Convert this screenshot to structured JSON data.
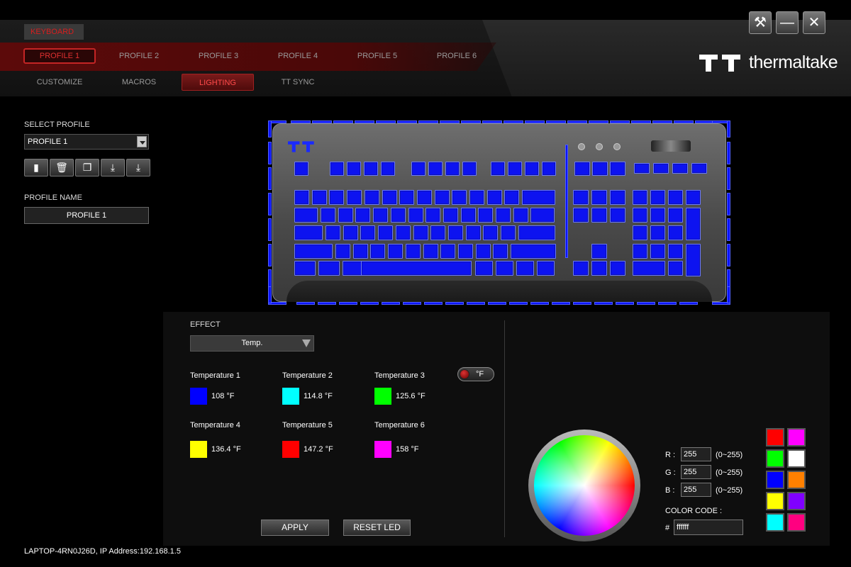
{
  "device_tab": "KEYBOARD",
  "profiles": [
    "PROFILE 1",
    "PROFILE 2",
    "PROFILE 3",
    "PROFILE 4",
    "PROFILE 5",
    "PROFILE 6"
  ],
  "sections": [
    "CUSTOMIZE",
    "MACROS",
    "LIGHTING",
    "TT SYNC"
  ],
  "brand": "thermaltake",
  "left": {
    "select_profile_label": "SELECT PROFILE",
    "selected_profile": "PROFILE 1",
    "profile_name_label": "PROFILE NAME",
    "profile_name": "PROFILE 1"
  },
  "effect": {
    "label": "EFFECT",
    "value": "Temp."
  },
  "unit_toggle": "°F",
  "temperatures": [
    {
      "title": "Temperature 1",
      "value": "108 °F",
      "color": "#0000ff"
    },
    {
      "title": "Temperature 2",
      "value": "114.8 °F",
      "color": "#00ffff"
    },
    {
      "title": "Temperature 3",
      "value": "125.6 °F",
      "color": "#00ff00"
    },
    {
      "title": "Temperature 4",
      "value": "136.4 °F",
      "color": "#ffff00"
    },
    {
      "title": "Temperature 5",
      "value": "147.2 °F",
      "color": "#ff0000"
    },
    {
      "title": "Temperature 6",
      "value": "158 °F",
      "color": "#ff00ff"
    }
  ],
  "buttons": {
    "apply": "APPLY",
    "reset": "RESET LED"
  },
  "rgb": {
    "r_label": "R :",
    "g_label": "G :",
    "b_label": "B :",
    "r": "255",
    "g": "255",
    "b": "255",
    "range": "(0~255)",
    "code_label": "COLOR CODE :",
    "hash": "#",
    "code": "ffffff"
  },
  "presets": [
    "#ff0000",
    "#ff00ff",
    "#00ff00",
    "#ffffff",
    "#0000ff",
    "#ff8000",
    "#ffff00",
    "#8000ff",
    "#00ffff",
    "#ff0080"
  ],
  "key_color": "#0d13f0",
  "status": "LAPTOP-4RN0J26D, IP Address:192.168.1.5"
}
